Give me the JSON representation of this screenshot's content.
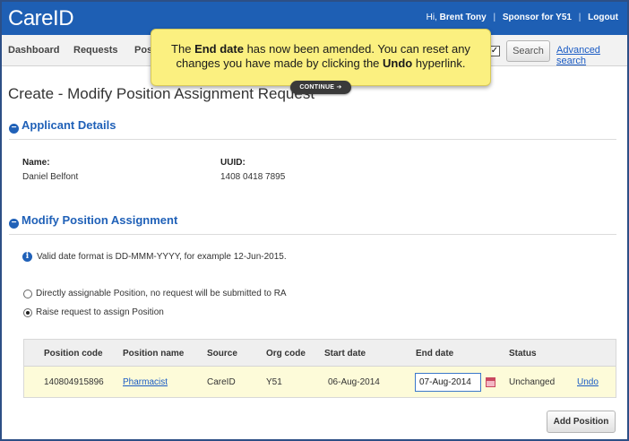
{
  "header": {
    "app_title": "CareID",
    "greeting": "Hi,",
    "user_name": "Brent Tony",
    "sep1": "|",
    "sponsor": "Sponsor for Y51",
    "sep2": "|",
    "logout_label": "Logout"
  },
  "nav": {
    "items": [
      {
        "label": "Dashboard"
      },
      {
        "label": "Requests"
      },
      {
        "label": "Pos"
      }
    ],
    "search_label": "Search",
    "advanced_search_label": "Advanced search",
    "checkbox_mark": "✓"
  },
  "tooltip": {
    "text_part1": "The ",
    "bold1": "End date",
    "text_part2": " has now been amended. You can reset any changes you have made by clicking the ",
    "bold2": "Undo",
    "text_part3": " hyperlink.",
    "continue_label": "CONTINUE ➔"
  },
  "page": {
    "title": "Create - Modify Position Assignment Request"
  },
  "applicant": {
    "heading": "Applicant Details",
    "name_label": "Name:",
    "name_value": "Daniel Belfont",
    "uuid_label": "UUID:",
    "uuid_value": "1408 0418 7895"
  },
  "modify": {
    "heading": "Modify Position Assignment",
    "info_icon_glyph": "i",
    "info_text": "Valid date format is DD-MMM-YYYY, for example 12-Jun-2015.",
    "radio1_label": "Directly assignable Position, no request will be submitted to RA",
    "radio2_label": "Raise request to assign Position",
    "selected_option": 2
  },
  "table": {
    "headers": [
      "Position code",
      "Position name",
      "Source",
      "Org code",
      "Start date",
      "End date",
      "Status"
    ],
    "row": {
      "position_code": "140804915896",
      "position_name": "Pharmacist",
      "source": "CareID",
      "org_code": "Y51",
      "start_date": "06-Aug-2014",
      "end_date": "07-Aug-2014",
      "status": "Unchanged",
      "action": "Undo"
    }
  },
  "actions": {
    "add_position_label": "Add Position"
  },
  "colors": {
    "header_blue": "#1e5fb4",
    "section_blue": "#2061b8",
    "link_blue": "#1a5bc4",
    "tooltip_yellow": "#fbf080",
    "row_highlight": "#fdfbd9"
  }
}
